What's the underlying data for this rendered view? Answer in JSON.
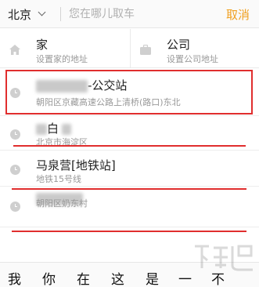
{
  "search_bar": {
    "city": "北京",
    "placeholder": "您在哪儿取车",
    "cancel_label": "取消"
  },
  "quick_places": {
    "home": {
      "title": "家",
      "subtitle": "设置家的地址"
    },
    "company": {
      "title": "公司",
      "subtitle": "设置公司地址"
    }
  },
  "history": [
    {
      "title_suffix": "-公交站",
      "subtitle": "朝阳区京藏高速公路上清桥(路口)东北"
    },
    {
      "title_suffix": "白",
      "subtitle": "北京市海淀区"
    },
    {
      "title": "马泉营[地铁站]",
      "subtitle": "地铁15号线"
    },
    {
      "subtitle": "朝阳区奶东村"
    }
  ],
  "keyboard_suggestions": [
    "我",
    "你",
    "在",
    "这",
    "是",
    "一",
    "不"
  ],
  "colors": {
    "accent": "#f0a020",
    "annotation": "#e02e2e"
  }
}
